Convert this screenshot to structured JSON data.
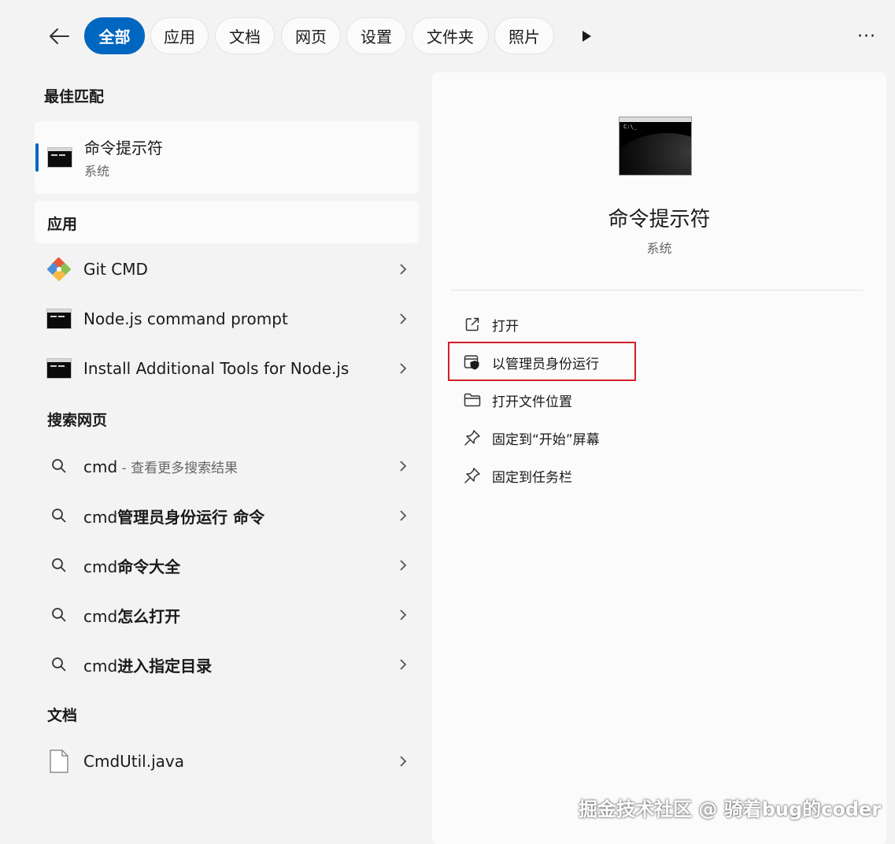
{
  "filters": {
    "tabs": [
      {
        "label": "全部",
        "active": true
      },
      {
        "label": "应用"
      },
      {
        "label": "文档"
      },
      {
        "label": "网页"
      },
      {
        "label": "设置"
      },
      {
        "label": "文件夹"
      },
      {
        "label": "照片"
      }
    ],
    "icons": {
      "back": "back-arrow-icon",
      "play": "play-icon",
      "more": "more-icon"
    },
    "more_glyph": "···"
  },
  "best_match": {
    "heading": "最佳匹配",
    "name": "命令提示符",
    "type": "系统"
  },
  "apps": {
    "heading": "应用",
    "items": [
      {
        "label": "Git CMD",
        "icon": "git-icon"
      },
      {
        "label": "Node.js command prompt",
        "icon": "cmd-icon"
      },
      {
        "label": "Install Additional Tools for Node.js",
        "icon": "cmd-icon"
      }
    ]
  },
  "web": {
    "heading": "搜索网页",
    "items": [
      {
        "prefix": "cmd",
        "suffix": " - 查看更多搜索结果"
      },
      {
        "prefix": "cmd",
        "bold": "管理员身份运行 命令"
      },
      {
        "prefix": "cmd",
        "bold": "命令大全"
      },
      {
        "prefix": "cmd",
        "bold": "怎么打开"
      },
      {
        "prefix": "cmd",
        "bold": "进入指定目录"
      }
    ]
  },
  "docs": {
    "heading": "文档",
    "items": [
      {
        "label": "CmdUtil.java",
        "icon": "document-icon"
      }
    ]
  },
  "detail": {
    "title": "命令提示符",
    "subtitle": "系统",
    "prompt_text": "C:\\_",
    "actions": [
      {
        "label": "打开",
        "icon": "open-external-icon"
      },
      {
        "label": "以管理员身份运行",
        "icon": "shield-admin-icon",
        "highlighted": true
      },
      {
        "label": "打开文件位置",
        "icon": "folder-icon"
      },
      {
        "label": "固定到“开始”屏幕",
        "icon": "pin-icon"
      },
      {
        "label": "固定到任务栏",
        "icon": "pin-icon"
      }
    ]
  },
  "watermark": "掘金技术社区 @ 骑着bug的coder",
  "colors": {
    "accent": "#0067c0",
    "highlight": "#d1202a",
    "background": "#f3f3f3"
  }
}
